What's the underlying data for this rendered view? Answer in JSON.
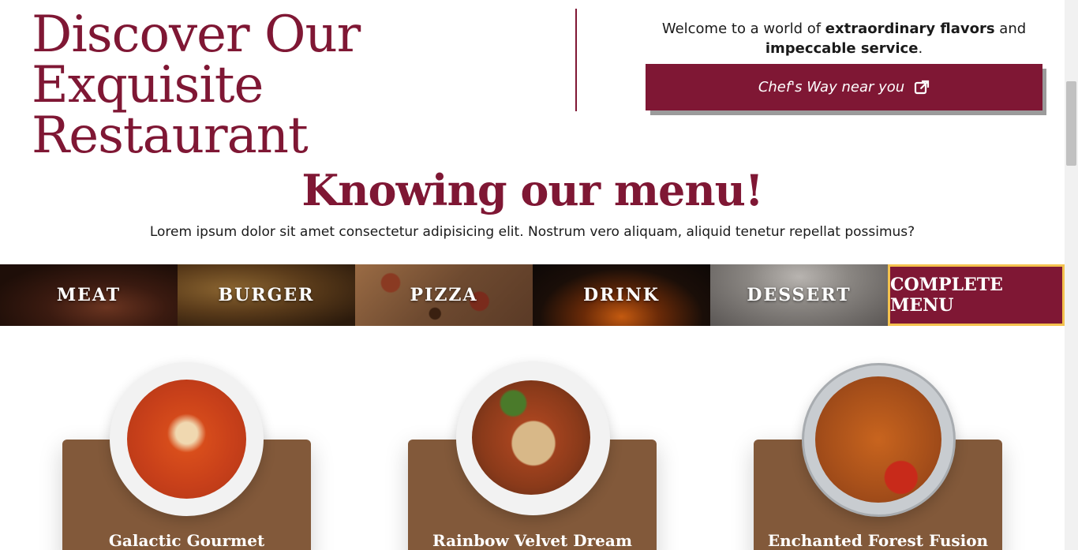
{
  "hero": {
    "title_line1": "Discover Our Exquisite",
    "title_line2": "Restaurant",
    "welcome_prefix": "Welcome to a world of ",
    "welcome_bold1": "extraordinary flavors",
    "welcome_mid": " and",
    "welcome_bold2": "impeccable service",
    "welcome_suffix": ".",
    "cta_label": "Chef's Way near you",
    "cta_icon": "external-link-icon"
  },
  "menu_section": {
    "heading": "Knowing our menu!",
    "subtitle": "Lorem ipsum dolor sit amet consectetur adipisicing elit. Nostrum vero aliquam, aliquid tenetur repellat possimus?"
  },
  "categories": [
    {
      "label": "MEAT"
    },
    {
      "label": "BURGER"
    },
    {
      "label": "PIZZA"
    },
    {
      "label": "DRINK"
    },
    {
      "label": "DESSERT"
    },
    {
      "label": "COMPLETE MENU"
    }
  ],
  "dishes": [
    {
      "title": "Galactic Gourmet"
    },
    {
      "title": "Rainbow Velvet Dream"
    },
    {
      "title": "Enchanted Forest Fusion"
    }
  ],
  "colors": {
    "brand": "#7f1734",
    "card": "#82593a",
    "accent_border": "#f4c24e"
  }
}
